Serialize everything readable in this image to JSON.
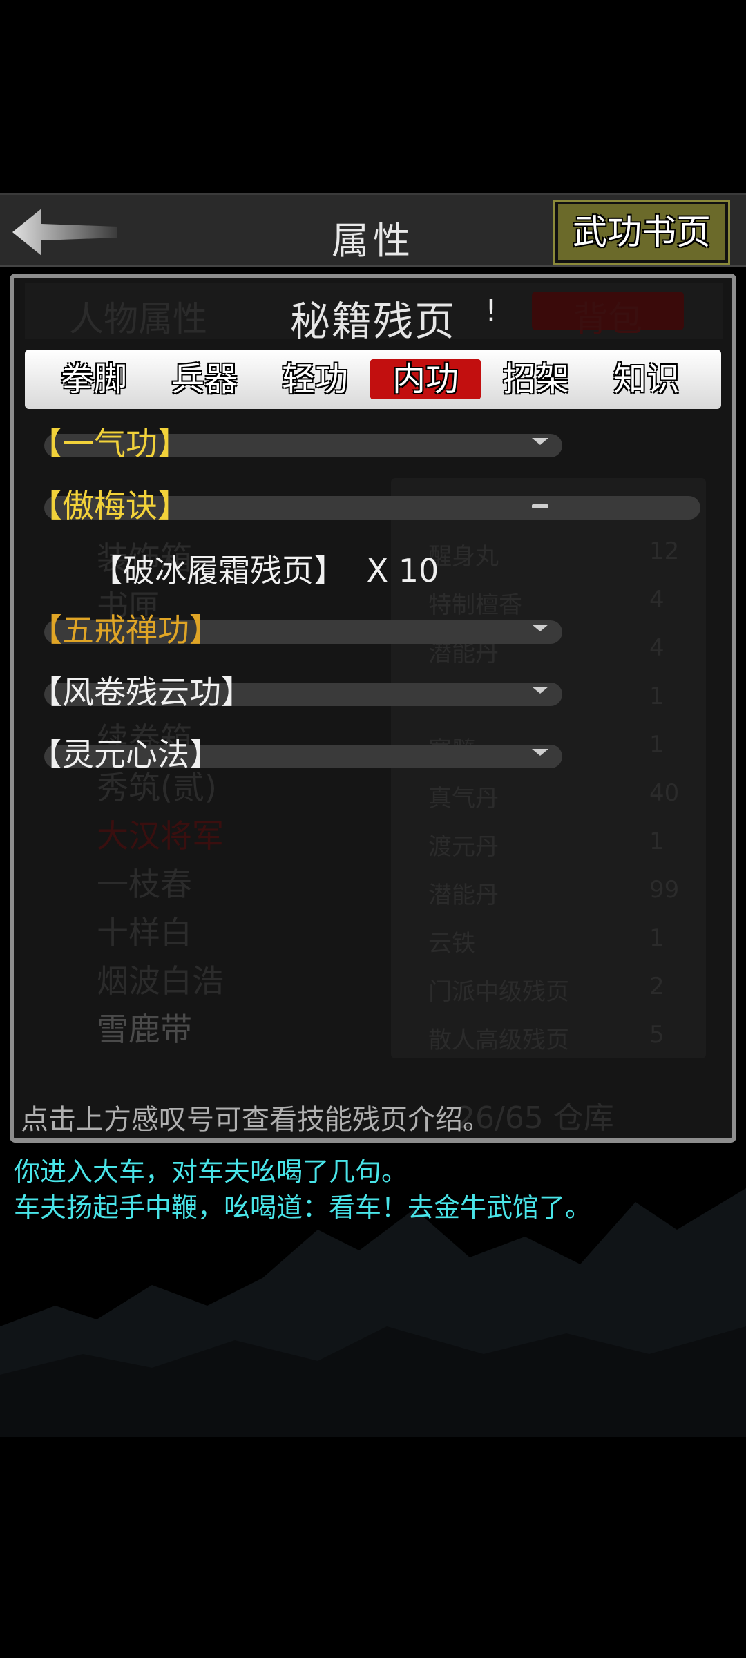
{
  "header": {
    "title": "属性",
    "right_button": "武功书页"
  },
  "panel": {
    "bg_tab_left": "人物属性",
    "bg_tab_right": "背包",
    "title": "秘籍残页",
    "info_mark": "!",
    "tabs": [
      {
        "label": "拳脚",
        "active": false
      },
      {
        "label": "兵器",
        "active": false
      },
      {
        "label": "轻功",
        "active": false
      },
      {
        "label": "内功",
        "active": true
      },
      {
        "label": "招架",
        "active": false
      },
      {
        "label": "知识",
        "active": false
      }
    ],
    "skills": [
      {
        "name": "【一气功】",
        "color": "#f2d23a",
        "state": "collapsed"
      },
      {
        "name": "【傲梅诀】",
        "color": "#f2d23a",
        "state": "expanded"
      },
      {
        "name": "【五戒禅功】",
        "color": "#e0a526",
        "state": "collapsed"
      },
      {
        "name": "【风卷残云功】",
        "color": "#f0f0f0",
        "state": "collapsed"
      },
      {
        "name": "【灵元心法】",
        "color": "#f0f0f0",
        "state": "collapsed"
      }
    ],
    "fragment": {
      "name": "【破冰履霜残页】",
      "qty": "X 10"
    },
    "hint": "点击上方感叹号可查看技能残页介绍。",
    "background": {
      "items_left": [
        "装饰箱",
        "书匣",
        "续卷箱",
        "秀筑(贰)",
        "大汉将军",
        "一枝春",
        "十样白",
        "烟波白浩",
        "雪鹿带"
      ],
      "items_right": [
        {
          "name": "醒身丸",
          "count": "12"
        },
        {
          "name": "特制檀香",
          "count": "4"
        },
        {
          "name": "潜能丹",
          "count": "4"
        },
        {
          "name": "",
          "count": "1"
        },
        {
          "name": "寒髓",
          "count": "1"
        },
        {
          "name": "真气丹",
          "count": "40"
        },
        {
          "name": "渡元丹",
          "count": "1"
        },
        {
          "name": "潜能丹",
          "count": "99"
        },
        {
          "name": "云铁",
          "count": "1"
        },
        {
          "name": "门派中级残页",
          "count": "2"
        },
        {
          "name": "散人高级残页",
          "count": "5"
        }
      ],
      "capacity": "26/65 仓库"
    }
  },
  "log": [
    "你进入大车，对车夫吆喝了几句。",
    "车夫扬起手中鞭，吆喝道：看车！去金牛武馆了。"
  ],
  "colors": {
    "active_tab": "#c20f0f",
    "log_text": "#49e4e8",
    "button_bg": "#6b6a2a"
  }
}
